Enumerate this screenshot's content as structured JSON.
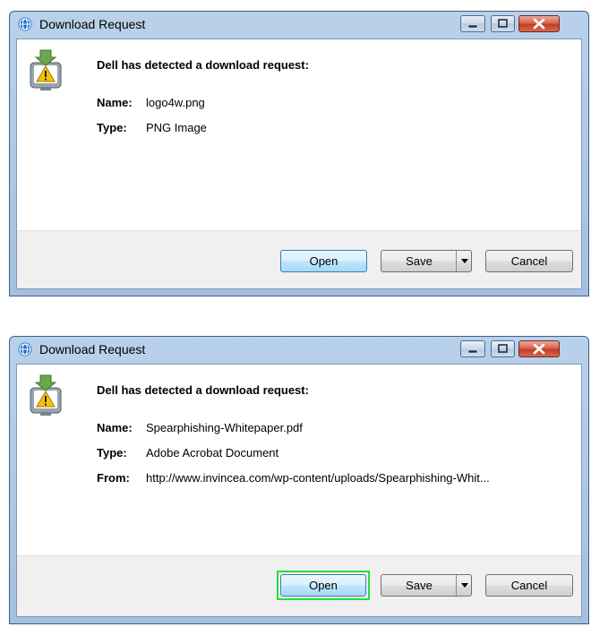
{
  "dialogs": [
    {
      "title": "Download Request",
      "heading": "Dell has detected a download request:",
      "fields": [
        {
          "label": "Name:",
          "value": "logo4w.png"
        },
        {
          "label": "Type:",
          "value": "PNG Image"
        }
      ],
      "buttons": {
        "open": "Open",
        "save": "Save",
        "cancel": "Cancel"
      }
    },
    {
      "title": "Download Request",
      "heading": "Dell has detected a download request:",
      "fields": [
        {
          "label": "Name:",
          "value": "Spearphishing-Whitepaper.pdf"
        },
        {
          "label": "Type:",
          "value": "Adobe Acrobat Document"
        },
        {
          "label": "From:",
          "value": "http://www.invincea.com/wp-content/uploads/Spearphishing-Whit..."
        }
      ],
      "buttons": {
        "open": "Open",
        "save": "Save",
        "cancel": "Cancel"
      }
    }
  ],
  "icons": {
    "title": "globe-icon",
    "dialog": "download-warning-icon",
    "minimize": "minimize-icon",
    "maximize": "maximize-icon",
    "close": "close-icon",
    "dropdown": "chevron-down-icon"
  },
  "colors": {
    "titlebar": "#b9d1ea",
    "close_button": "#c33d25",
    "open_highlight": "#22e03a",
    "warning": "#f5c400",
    "download_arrow": "#6aa84f"
  }
}
